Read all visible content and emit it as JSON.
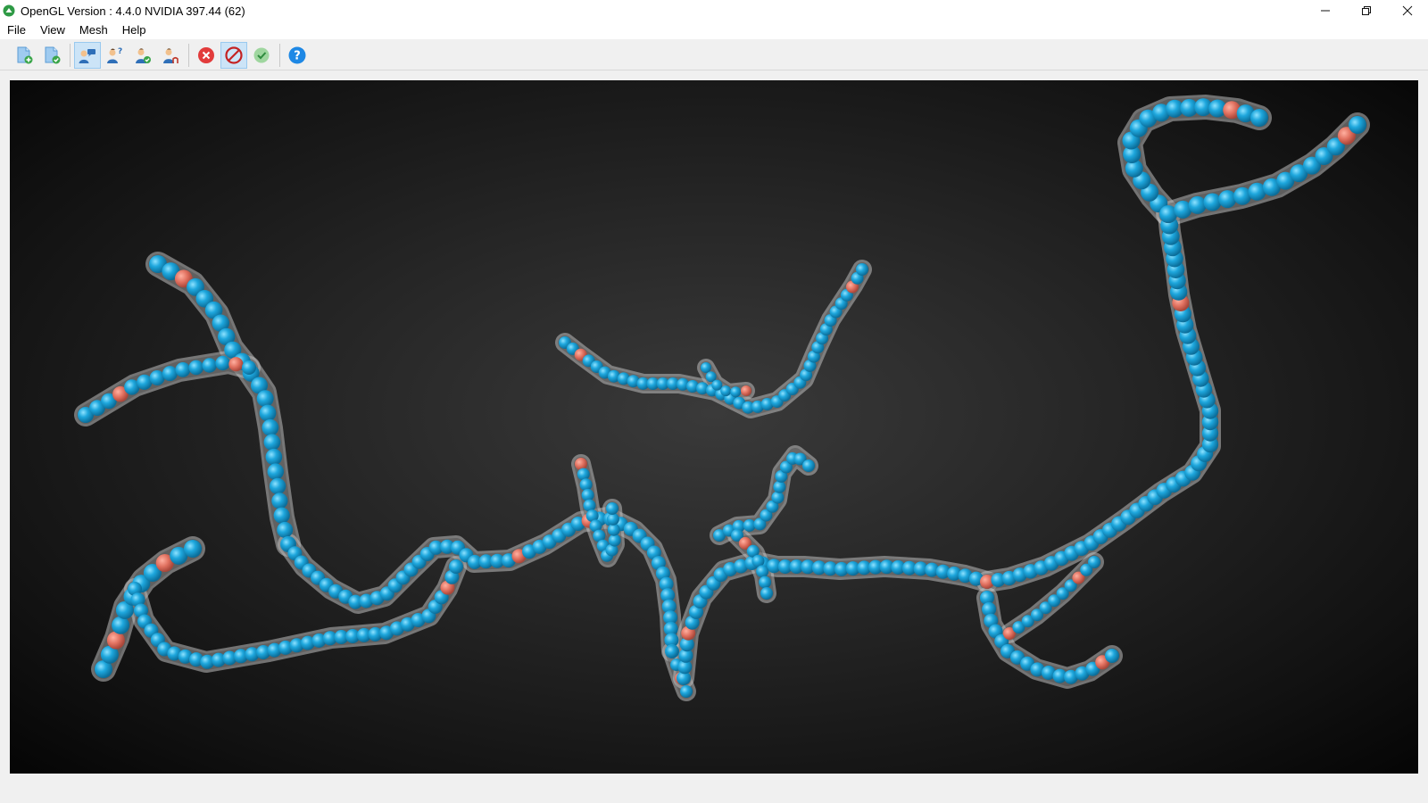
{
  "window": {
    "title": "OpenGL Version : 4.4.0 NVIDIA 397.44 (62)",
    "controls": {
      "minimize": "—",
      "restore": "❐",
      "close": "✕"
    }
  },
  "menu": {
    "items": [
      "File",
      "View",
      "Mesh",
      "Help"
    ]
  },
  "toolbar": {
    "buttons": [
      {
        "icon": "new-file-add-icon",
        "active": false
      },
      {
        "icon": "file-check-icon",
        "active": false
      },
      {
        "icon": "users-chat-icon",
        "active": true
      },
      {
        "icon": "user-question-icon",
        "active": false
      },
      {
        "icon": "user-check-icon",
        "active": false
      },
      {
        "icon": "user-edit-icon",
        "active": false
      },
      {
        "icon": "cancel-red-icon",
        "active": false
      },
      {
        "icon": "prohibit-icon",
        "active": true
      },
      {
        "icon": "accept-green-icon",
        "active": false
      },
      {
        "icon": "help-icon",
        "active": false
      }
    ]
  },
  "colors": {
    "bead": "#1fa8dc",
    "bead_highlight": "#7fdcff",
    "node": "#e0705f",
    "tube": "#9a9a9a"
  }
}
